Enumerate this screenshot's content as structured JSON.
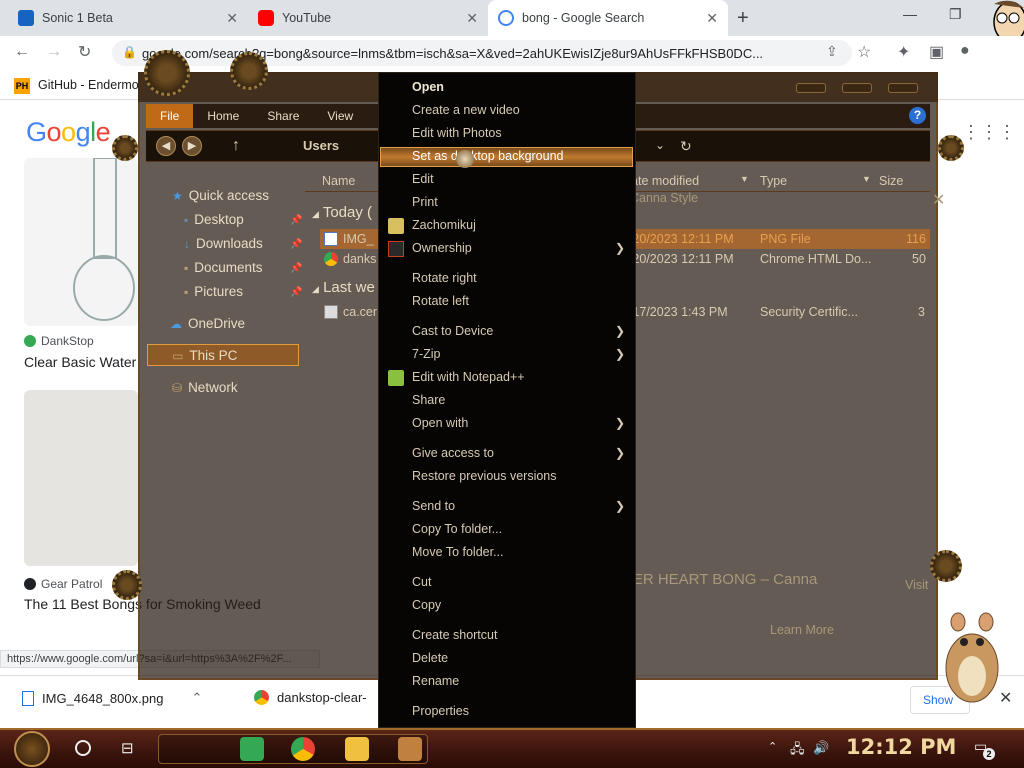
{
  "browser": {
    "tabs": [
      {
        "title": "Sonic 1 Beta",
        "favicon_color": "#1565c0",
        "active": false
      },
      {
        "title": "YouTube",
        "favicon_color": "#ff0000",
        "active": false
      },
      {
        "title": "bong - Google Search",
        "favicon_color": "#4285f4",
        "active": true
      }
    ],
    "new_tab": "+",
    "address": "google.com/search?q=bong&source=lnms&tbm=isch&sa=X&ved=2ahUKEwisIZje8ur9AhUsFFkFHSB0DC...",
    "bookmark": {
      "icon_text": "PH",
      "label": "GitHub - Endermo"
    }
  },
  "google": {
    "logo_letters": [
      "G",
      "o",
      "o",
      "g",
      "l",
      "e"
    ],
    "results": [
      {
        "source": "DankStop",
        "source_color": "#34a853",
        "title": "Clear Basic Water"
      },
      {
        "source": "Gear Patrol",
        "source_color": "#202124",
        "title": "The 11 Best Bongs for Smoking Weed"
      }
    ],
    "preview_title": "DER HEART BONG – Canna",
    "preview_learn": "Learn More",
    "preview_visit": "Visit",
    "preview_right": "Canna Style",
    "status_url": "https://www.google.com/url?sa=i&url=https%3A%2F%2F..."
  },
  "downloads": {
    "items": [
      {
        "name": "IMG_4648_800x.png"
      },
      {
        "name": "dankstop-clear-"
      }
    ],
    "show_all": "Show"
  },
  "explorer": {
    "ribbon": [
      "File",
      "Home",
      "Share",
      "View"
    ],
    "address_crumb": "Users",
    "nav": [
      {
        "label": "Quick access",
        "icon": "star-icon"
      },
      {
        "label": "Desktop",
        "icon": "folder-icon"
      },
      {
        "label": "Downloads",
        "icon": "download-icon"
      },
      {
        "label": "Documents",
        "icon": "folder-icon"
      },
      {
        "label": "Pictures",
        "icon": "folder-icon"
      },
      {
        "label": "OneDrive",
        "icon": "cloud-icon"
      },
      {
        "label": "This PC",
        "icon": "computer-icon"
      },
      {
        "label": "Network",
        "icon": "network-icon"
      }
    ],
    "columns": {
      "name": "Name",
      "date": "Date modified",
      "type": "Type",
      "size": "Size"
    },
    "groups": [
      {
        "label": "Today (",
        "rows": [
          {
            "name": "IMG_",
            "date": "3/20/2023 12:11 PM",
            "type": "PNG File",
            "size": "116",
            "selected": true
          },
          {
            "name": "danks",
            "date": "3/20/2023 12:11 PM",
            "type": "Chrome HTML Do...",
            "size": "50",
            "selected": false
          }
        ]
      },
      {
        "label": "Last we",
        "rows": [
          {
            "name": "ca.cer",
            "date": "3/17/2023 1:43 PM",
            "type": "Security Certific...",
            "size": "3",
            "selected": false
          }
        ]
      }
    ]
  },
  "context_menu": {
    "items": [
      {
        "label": "Open",
        "bold": true
      },
      {
        "label": "Create a new video"
      },
      {
        "label": "Edit with Photos"
      },
      {
        "label": "Set as desktop background",
        "highlighted": true
      },
      {
        "label": "Edit"
      },
      {
        "label": "Print"
      },
      {
        "label": "Zachomikuj",
        "icon": "zachomikuj-icon"
      },
      {
        "label": "Ownership",
        "icon": "ownership-icon",
        "submenu": true
      },
      {
        "label": "Rotate right"
      },
      {
        "label": "Rotate left"
      },
      {
        "label": "Cast to Device",
        "submenu": true
      },
      {
        "label": "7-Zip",
        "submenu": true
      },
      {
        "label": "Edit with Notepad++",
        "icon": "notepadpp-icon"
      },
      {
        "label": "Share"
      },
      {
        "label": "Open with",
        "submenu": true
      },
      {
        "label": "Give access to",
        "submenu": true
      },
      {
        "label": "Restore previous versions"
      },
      {
        "label": "Send to",
        "submenu": true
      },
      {
        "label": "Copy To folder..."
      },
      {
        "label": "Move To folder..."
      },
      {
        "label": "Cut"
      },
      {
        "label": "Copy"
      },
      {
        "label": "Create shortcut"
      },
      {
        "label": "Delete"
      },
      {
        "label": "Rename"
      },
      {
        "label": "Properties"
      }
    ],
    "submenu_arrow": "❯"
  },
  "taskbar": {
    "clock": "12:12 PM",
    "notification_count": "2"
  }
}
